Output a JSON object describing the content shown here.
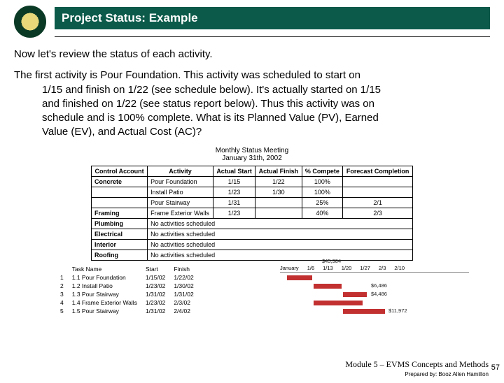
{
  "header": {
    "title": "Project Status: Example"
  },
  "body": {
    "intro": "Now let's review the status of each activity.",
    "para_lead": "The first activity is Pour Foundation.  This activity was scheduled to start on",
    "para_cont1": "1/15 and finish on 1/22 (see schedule below).   It's actually started on 1/15",
    "para_cont2": "and finished on 1/22 (see status report below).  Thus this activity was on",
    "para_cont3": "schedule and is 100% complete.  What is its Planned Value (PV), Earned",
    "para_cont4": "Value (EV), and Actual Cost (AC)?"
  },
  "status_table": {
    "title_line1": "Monthly Status Meeting",
    "title_line2": "January 31th, 2002",
    "headers": [
      "Control Account",
      "Activity",
      "Actual Start",
      "Actual Finish",
      "% Compete",
      "Forecast Completion"
    ],
    "rows": [
      {
        "ca": "Concrete",
        "act": "Pour Foundation",
        "as": "1/15",
        "af": "1/22",
        "pc": "100%",
        "fc": ""
      },
      {
        "ca": "",
        "act": "Install Patio",
        "as": "1/23",
        "af": "1/30",
        "pc": "100%",
        "fc": ""
      },
      {
        "ca": "",
        "act": "Pour Stairway",
        "as": "1/31",
        "af": "",
        "pc": "25%",
        "fc": "2/1"
      },
      {
        "ca": "Framing",
        "act": "Frame Exterior Walls",
        "as": "1/23",
        "af": "",
        "pc": "40%",
        "fc": "2/3"
      },
      {
        "ca": "Plumbing",
        "act": "No activities scheduled",
        "as": "",
        "af": "",
        "pc": "",
        "fc": ""
      },
      {
        "ca": "Electrical",
        "act": "No activities scheduled",
        "as": "",
        "af": "",
        "pc": "",
        "fc": ""
      },
      {
        "ca": "Interior",
        "act": "No activities scheduled",
        "as": "",
        "af": "",
        "pc": "",
        "fc": ""
      },
      {
        "ca": "Roofing",
        "act": "No activities scheduled",
        "as": "",
        "af": "",
        "pc": "",
        "fc": ""
      }
    ]
  },
  "schedule": {
    "header_cols": [
      "Task Name",
      "Start",
      "Finish"
    ],
    "rows": [
      {
        "idx": "1",
        "name": "1.1 Pour Foundation",
        "start": "1/15/02",
        "finish": "1/22/02"
      },
      {
        "idx": "2",
        "name": "1.2 Install Patio",
        "start": "1/23/02",
        "finish": "1/30/02"
      },
      {
        "idx": "3",
        "name": "1.3 Pour Stairway",
        "start": "1/31/02",
        "finish": "1/31/02"
      },
      {
        "idx": "4",
        "name": "1.4 Frame Exterior Walls",
        "start": "1/23/02",
        "finish": "2/3/02"
      },
      {
        "idx": "5",
        "name": "1.5 Pour Stairway",
        "start": "1/31/02",
        "finish": "2/4/02"
      }
    ],
    "gantt_header": [
      "January",
      "1/6",
      "1/13",
      "1/20",
      "1/27",
      "2/3",
      "2/10"
    ],
    "values": {
      "top": "$45,984",
      "mid": "$6,486",
      "r2": "$4,486",
      "bot": "$11,972"
    }
  },
  "footer": {
    "module": "Module 5 – EVMS Concepts and Methods",
    "prepared": "Prepared by: Booz Allen Hamilton",
    "page": "57"
  }
}
